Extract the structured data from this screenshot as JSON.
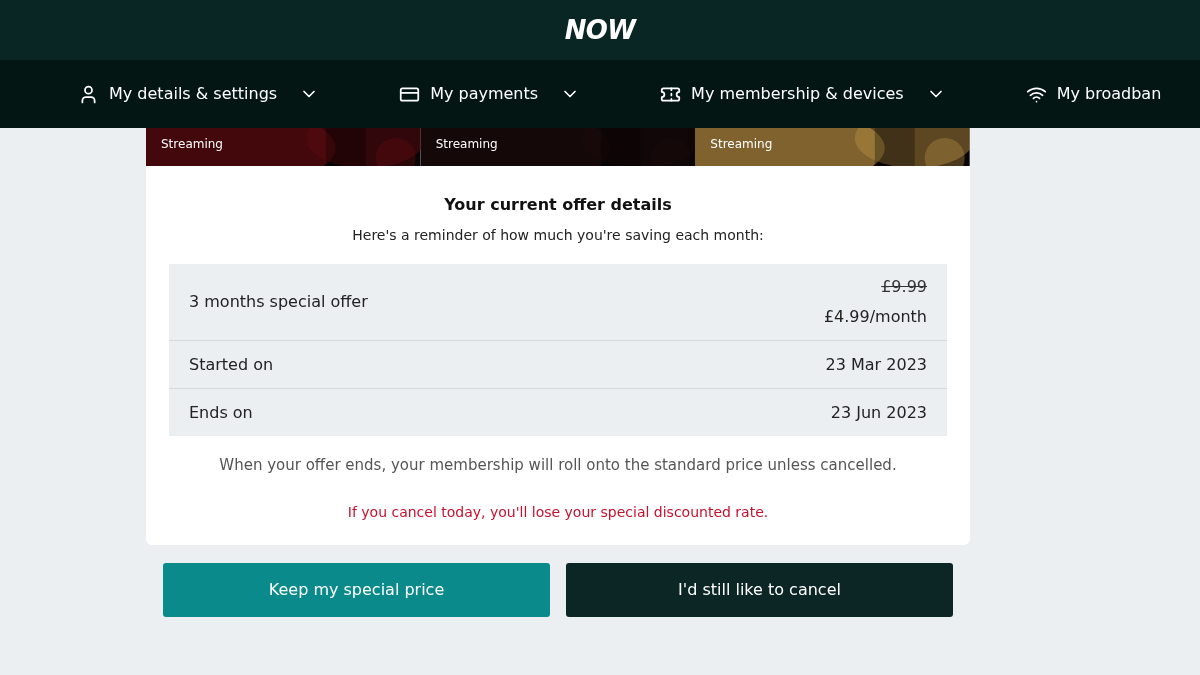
{
  "header": {
    "logo": "NOW"
  },
  "nav": [
    {
      "label": "My details & settings"
    },
    {
      "label": "My payments"
    },
    {
      "label": "My membership & devices"
    },
    {
      "label": "My broadban"
    }
  ],
  "posters": [
    {
      "caption": "Streaming"
    },
    {
      "caption": "Streaming"
    },
    {
      "caption": "Streaming"
    }
  ],
  "offer": {
    "title": "Your current offer details",
    "subtitle": "Here's a reminder of how much you're saving each month:",
    "rows": [
      {
        "label": "3 months special offer",
        "old_price": "£9.99",
        "value": "£4.99/month"
      },
      {
        "label": "Started on",
        "value": "23 Mar 2023"
      },
      {
        "label": "Ends on",
        "value": "23 Jun 2023"
      }
    ],
    "note": "When your offer ends, your membership will roll onto the standard price unless cancelled.",
    "warning": "If you cancel today, you'll lose your special discounted rate."
  },
  "buttons": [
    {
      "label": "Keep my special price",
      "kind": "primary"
    },
    {
      "label": "I'd still like to cancel",
      "kind": "secondary"
    }
  ]
}
